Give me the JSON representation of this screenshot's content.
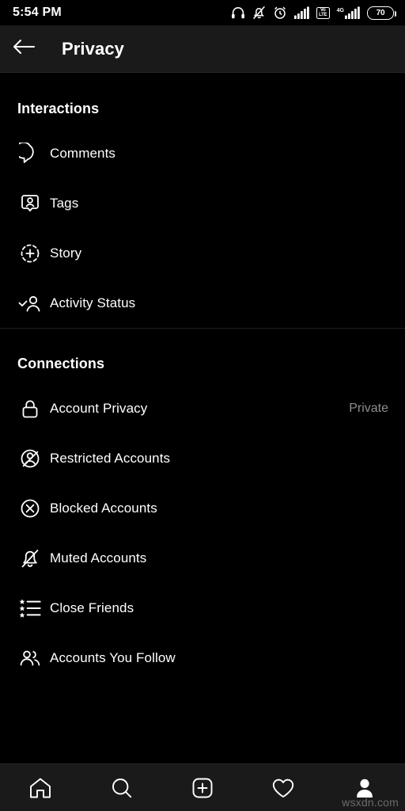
{
  "status_bar": {
    "time": "5:54 PM",
    "battery_level": "70",
    "volte_top": "Vo",
    "volte_bottom": "LTE",
    "network_label": "4G",
    "icons": [
      "headphones-icon",
      "bell-off-icon",
      "alarm-clock-icon",
      "signal-bars-icon",
      "volte-icon",
      "signal-bars-4g-icon",
      "battery-icon"
    ]
  },
  "app_bar": {
    "title": "Privacy",
    "back_icon": "back-arrow-icon"
  },
  "sections": [
    {
      "title": "Interactions",
      "rows": [
        {
          "label": "Comments",
          "icon": "comment-bubble-icon",
          "value": ""
        },
        {
          "label": "Tags",
          "icon": "tag-person-icon",
          "value": ""
        },
        {
          "label": "Story",
          "icon": "story-plus-icon",
          "value": ""
        },
        {
          "label": "Activity Status",
          "icon": "activity-status-icon",
          "value": ""
        }
      ]
    },
    {
      "title": "Connections",
      "rows": [
        {
          "label": "Account Privacy",
          "icon": "lock-icon",
          "value": "Private"
        },
        {
          "label": "Restricted Accounts",
          "icon": "restricted-user-icon",
          "value": ""
        },
        {
          "label": "Blocked Accounts",
          "icon": "blocked-circle-icon",
          "value": ""
        },
        {
          "label": "Muted Accounts",
          "icon": "bell-muted-icon",
          "value": ""
        },
        {
          "label": "Close Friends",
          "icon": "star-list-icon",
          "value": ""
        },
        {
          "label": "Accounts You Follow",
          "icon": "two-people-icon",
          "value": ""
        }
      ]
    }
  ],
  "bottom_nav": [
    {
      "name": "home-icon",
      "label": "Home"
    },
    {
      "name": "search-icon",
      "label": "Search"
    },
    {
      "name": "create-icon",
      "label": "Create"
    },
    {
      "name": "heart-icon",
      "label": "Activity"
    },
    {
      "name": "profile-icon",
      "label": "Profile"
    }
  ],
  "watermark": "wsxdn.com",
  "colors": {
    "background": "#000000",
    "bar_background": "#1a1a1a",
    "text_primary": "#ffffff",
    "text_secondary": "#8e8e8e",
    "divider": "#1f1f1f"
  }
}
